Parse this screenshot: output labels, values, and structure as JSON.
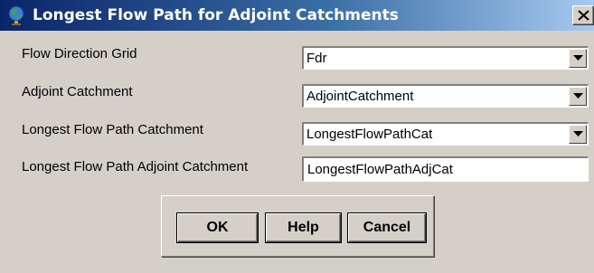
{
  "window": {
    "title": "Longest Flow Path for Adjoint Catchments",
    "title_icon": "globe-icon",
    "close_icon": "close-icon"
  },
  "fields": {
    "flow_direction": {
      "label": "Flow Direction Grid",
      "value": "Fdr"
    },
    "adjoint_catchment": {
      "label": "Adjoint Catchment",
      "value": "AdjointCatchment"
    },
    "longest_flow_path_catchment": {
      "label": "Longest Flow Path Catchment",
      "value": "LongestFlowPathCat"
    },
    "longest_flow_path_adjoint": {
      "label": "Longest Flow Path Adjoint Catchment",
      "value": "LongestFlowPathAdjCat"
    }
  },
  "buttons": {
    "ok": "OK",
    "help": "Help",
    "cancel": "Cancel"
  },
  "colors": {
    "titlebar_start": "#0a246a",
    "titlebar_end": "#a6caf0",
    "dialog_face": "#d4d0c8"
  }
}
